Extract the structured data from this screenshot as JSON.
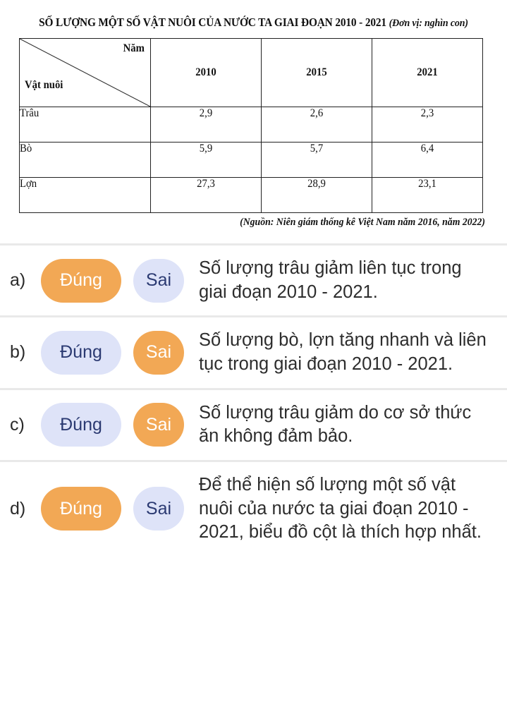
{
  "title": {
    "main": "SỐ LƯỢNG MỘT SỐ VẬT NUÔI CỦA NƯỚC TA GIAI ĐOẠN 2010 - 2021",
    "unit": "(Đơn vị: nghìn con)"
  },
  "table": {
    "corner_year_label": "Năm",
    "corner_animal_label": "Vật nuôi",
    "columns": [
      "2010",
      "2015",
      "2021"
    ],
    "rows": [
      {
        "label": "Trâu",
        "values": [
          "2,9",
          "2,6",
          "2,3"
        ]
      },
      {
        "label": "Bò",
        "values": [
          "5,9",
          "5,7",
          "6,4"
        ]
      },
      {
        "label": "Lợn",
        "values": [
          "27,3",
          "28,9",
          "23,1"
        ]
      }
    ],
    "source": "(Nguồn: Niên giám thống kê Việt Nam năm 2016, năm 2022)"
  },
  "options": {
    "true_label": "Đúng",
    "false_label": "Sai",
    "selected_color": "#f2a855",
    "unselected_color": "#dee3f8",
    "selected_text_color": "#ffffff",
    "unselected_text_color": "#2b3a72"
  },
  "questions": [
    {
      "key": "a)",
      "text": "Số lượng trâu giảm liên tục trong giai đoạn 2010 - 2021.",
      "selected": "Đúng"
    },
    {
      "key": "b)",
      "text": "Số lượng bò, lợn tăng nhanh và liên tục trong giai đoạn 2010 - 2021.",
      "selected": "Sai"
    },
    {
      "key": "c)",
      "text": "Số lượng trâu giảm do cơ sở thức ăn không đảm bảo.",
      "selected": "Sai"
    },
    {
      "key": "d)",
      "text": "Để thể hiện số lượng một số vật nuôi của nước ta giai đoạn 2010 - 2021, biểu đồ cột là thích hợp nhất.",
      "selected": "Đúng"
    }
  ],
  "chart_data": {
    "type": "table",
    "title": "SỐ LƯỢNG MỘT SỐ VẬT NUÔI CỦA NƯỚC TA GIAI ĐOẠN 2010 - 2021",
    "unit": "nghìn con",
    "categories": [
      "2010",
      "2015",
      "2021"
    ],
    "xlabel": "Năm",
    "ylabel": "Vật nuôi",
    "series": [
      {
        "name": "Trâu",
        "values": [
          2.9,
          2.6,
          2.3
        ]
      },
      {
        "name": "Bò",
        "values": [
          5.9,
          5.7,
          6.4
        ]
      },
      {
        "name": "Lợn",
        "values": [
          27.3,
          28.9,
          23.1
        ]
      }
    ],
    "source": "(Nguồn: Niên giám thống kê Việt Nam năm 2016, năm 2022)"
  }
}
